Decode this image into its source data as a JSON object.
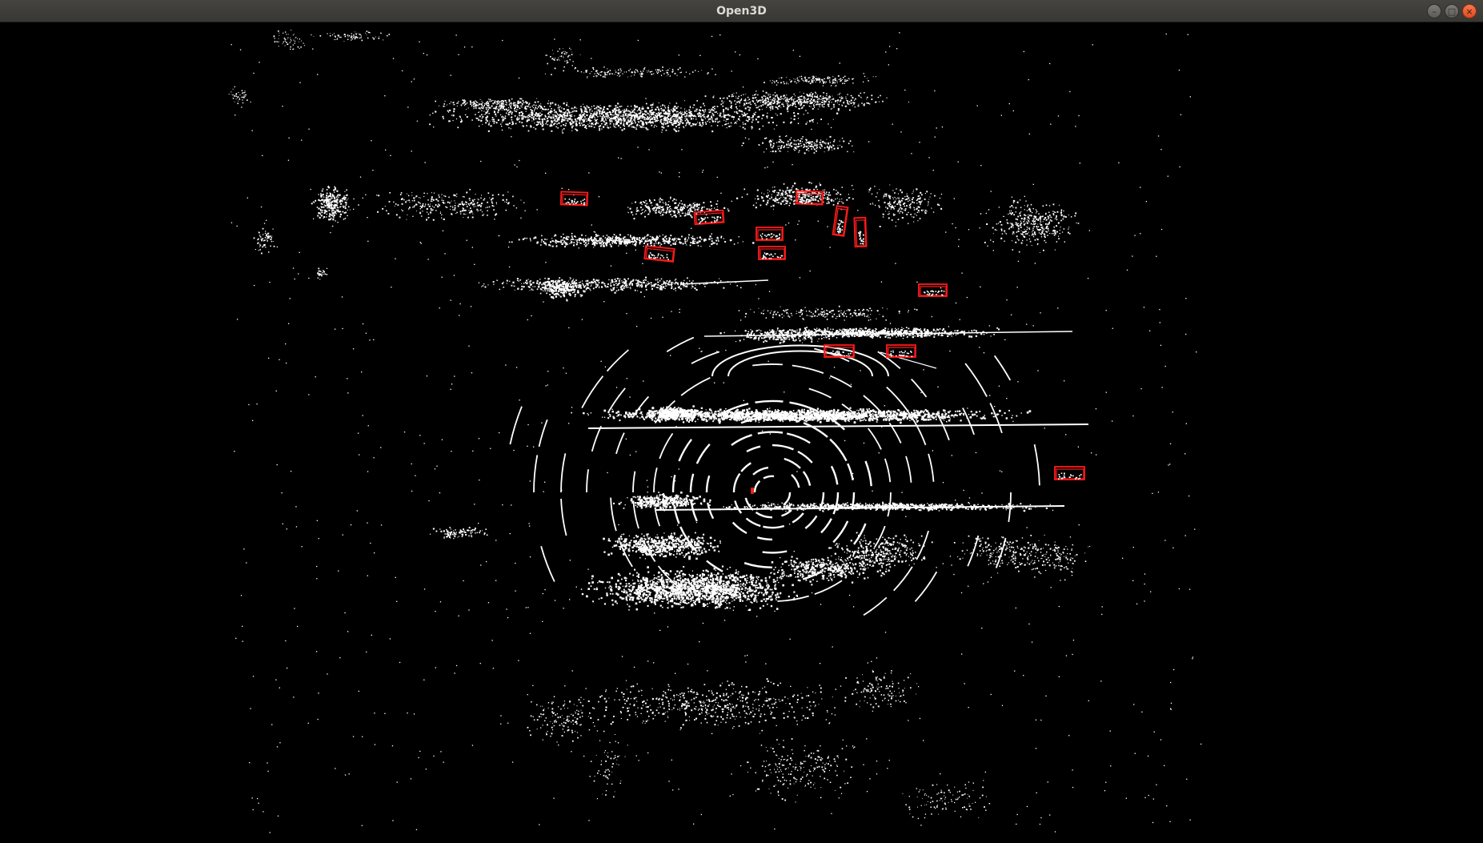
{
  "window": {
    "title": "Open3D",
    "controls": {
      "minimize_icon": "minimize-icon",
      "maximize_icon": "maximize-icon",
      "close_icon": "close-icon"
    },
    "minimize_glyph": "–",
    "maximize_glyph": "□",
    "close_glyph": "×"
  },
  "viewport": {
    "background": "#000000",
    "point_color": "#ffffff",
    "box_color": "#ff0000",
    "content": "lidar-point-cloud",
    "bounding_box_count": 12
  }
}
